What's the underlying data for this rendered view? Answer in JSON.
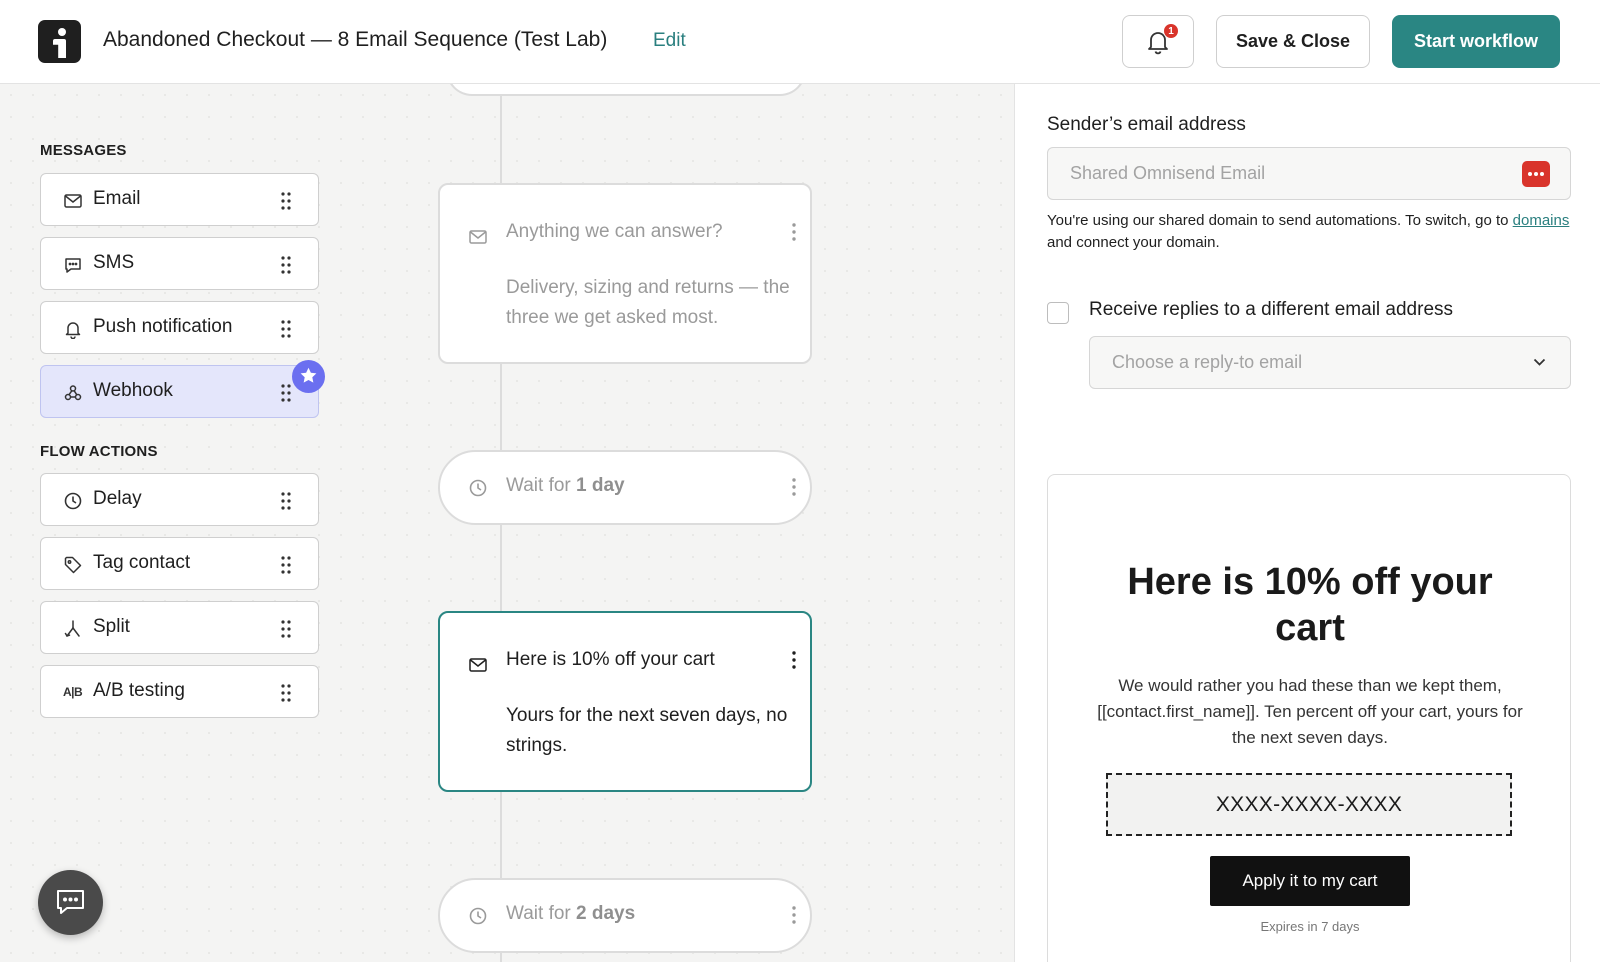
{
  "header": {
    "title": "Abandoned Checkout — 8 Email Sequence (Test Lab)",
    "edit_label": "Edit",
    "notification_count": "1",
    "save_label": "Save & Close",
    "start_label": "Start workflow",
    "accent_color": "#2a8683"
  },
  "palette": {
    "messages_label": "MESSAGES",
    "messages": [
      {
        "label": "Email",
        "icon": "mail-icon"
      },
      {
        "label": "SMS",
        "icon": "sms-icon"
      },
      {
        "label": "Push notification",
        "icon": "bell-icon"
      },
      {
        "label": "Webhook",
        "icon": "webhook-icon",
        "active": true
      }
    ],
    "flow_actions_label": "FLOW ACTIONS",
    "flow_actions": [
      {
        "label": "Delay",
        "icon": "clock-icon"
      },
      {
        "label": "Tag contact",
        "icon": "tag-icon"
      },
      {
        "label": "Split",
        "icon": "split-icon"
      },
      {
        "label": "A/B testing",
        "icon": "ab-icon",
        "icon_text": "A|B"
      }
    ]
  },
  "flow": {
    "cards": [
      {
        "title": "Anything we can answer?",
        "body": "Delivery, sizing and returns — the three we get asked most."
      },
      {
        "title": "Here is 10% off your cart",
        "body": "Yours for the next seven days, no strings."
      }
    ],
    "waits": [
      {
        "prefix": "Wait for",
        "amount": "1 day"
      },
      {
        "prefix": "Wait for",
        "amount": "2 days"
      }
    ]
  },
  "panel": {
    "sender_label": "Sender’s email address",
    "sender_placeholder": "Shared Omnisend Email",
    "help_before": "You're using our shared domain to send automations. To switch, go to ",
    "help_link": "domains",
    "help_after": " and connect your domain.",
    "reply_checkbox_label": "Receive replies to a different email address",
    "reply_placeholder": "Choose a reply-to email"
  },
  "preview": {
    "title": "Here is 10% off your cart",
    "body": "We would rather you had these than we kept them, [[contact.first_name]]. Ten percent off your cart, yours for the next seven days.",
    "code": "XXXX-XXXX-XXXX",
    "button": "Apply it to my cart",
    "expires": "Expires in 7 days"
  }
}
